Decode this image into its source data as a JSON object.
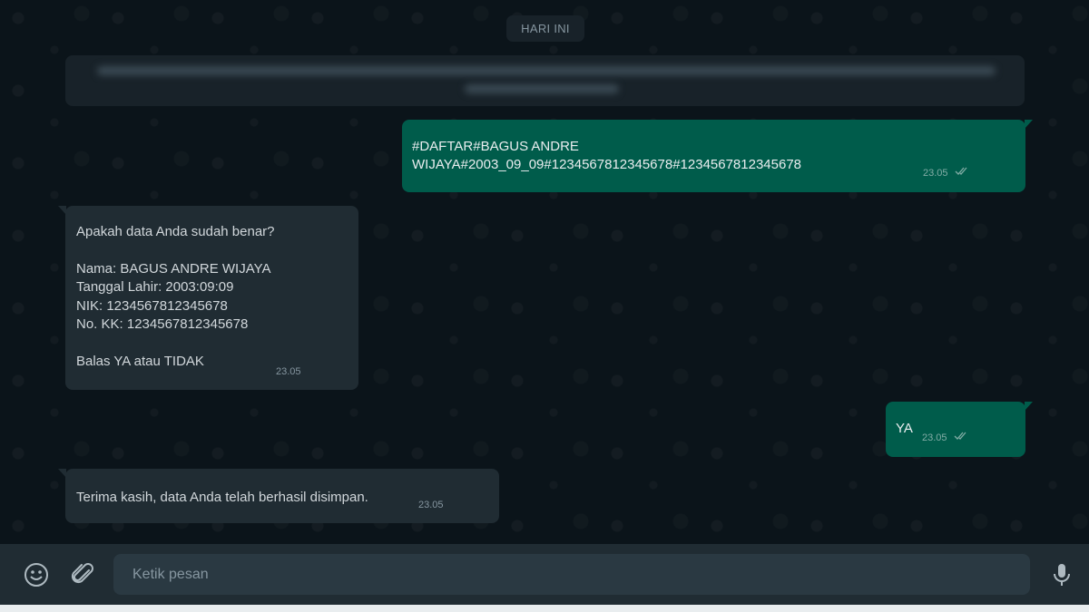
{
  "chat": {
    "date_chip": "HARI INI",
    "messages": [
      {
        "direction": "out",
        "text": "#DAFTAR#BAGUS ANDRE\nWIJAYA#2003_09_09#1234567812345678#1234567812345678",
        "time": "23.05",
        "status": "double-check-icon"
      },
      {
        "direction": "in",
        "text": "Apakah data Anda sudah benar?\n\nNama: BAGUS ANDRE WIJAYA\nTanggal Lahir: 2003:09:09\nNIK: 1234567812345678\nNo. KK: 1234567812345678\n\nBalas YA atau TIDAK",
        "time": "23.05"
      },
      {
        "direction": "out",
        "text": "YA",
        "time": "23.05",
        "status": "double-check-icon"
      },
      {
        "direction": "in",
        "text": "Terima kasih, data Anda telah berhasil disimpan.",
        "time": "23.05"
      }
    ]
  },
  "composer": {
    "placeholder": "Ketik pesan",
    "value": "",
    "icons": [
      "emoji-icon",
      "attach-icon",
      "microphone-icon"
    ]
  },
  "colors": {
    "background": "#0b141a",
    "outgoing_bubble": "#005c4b",
    "incoming_bubble": "#202c33",
    "footer": "#202c33"
  }
}
